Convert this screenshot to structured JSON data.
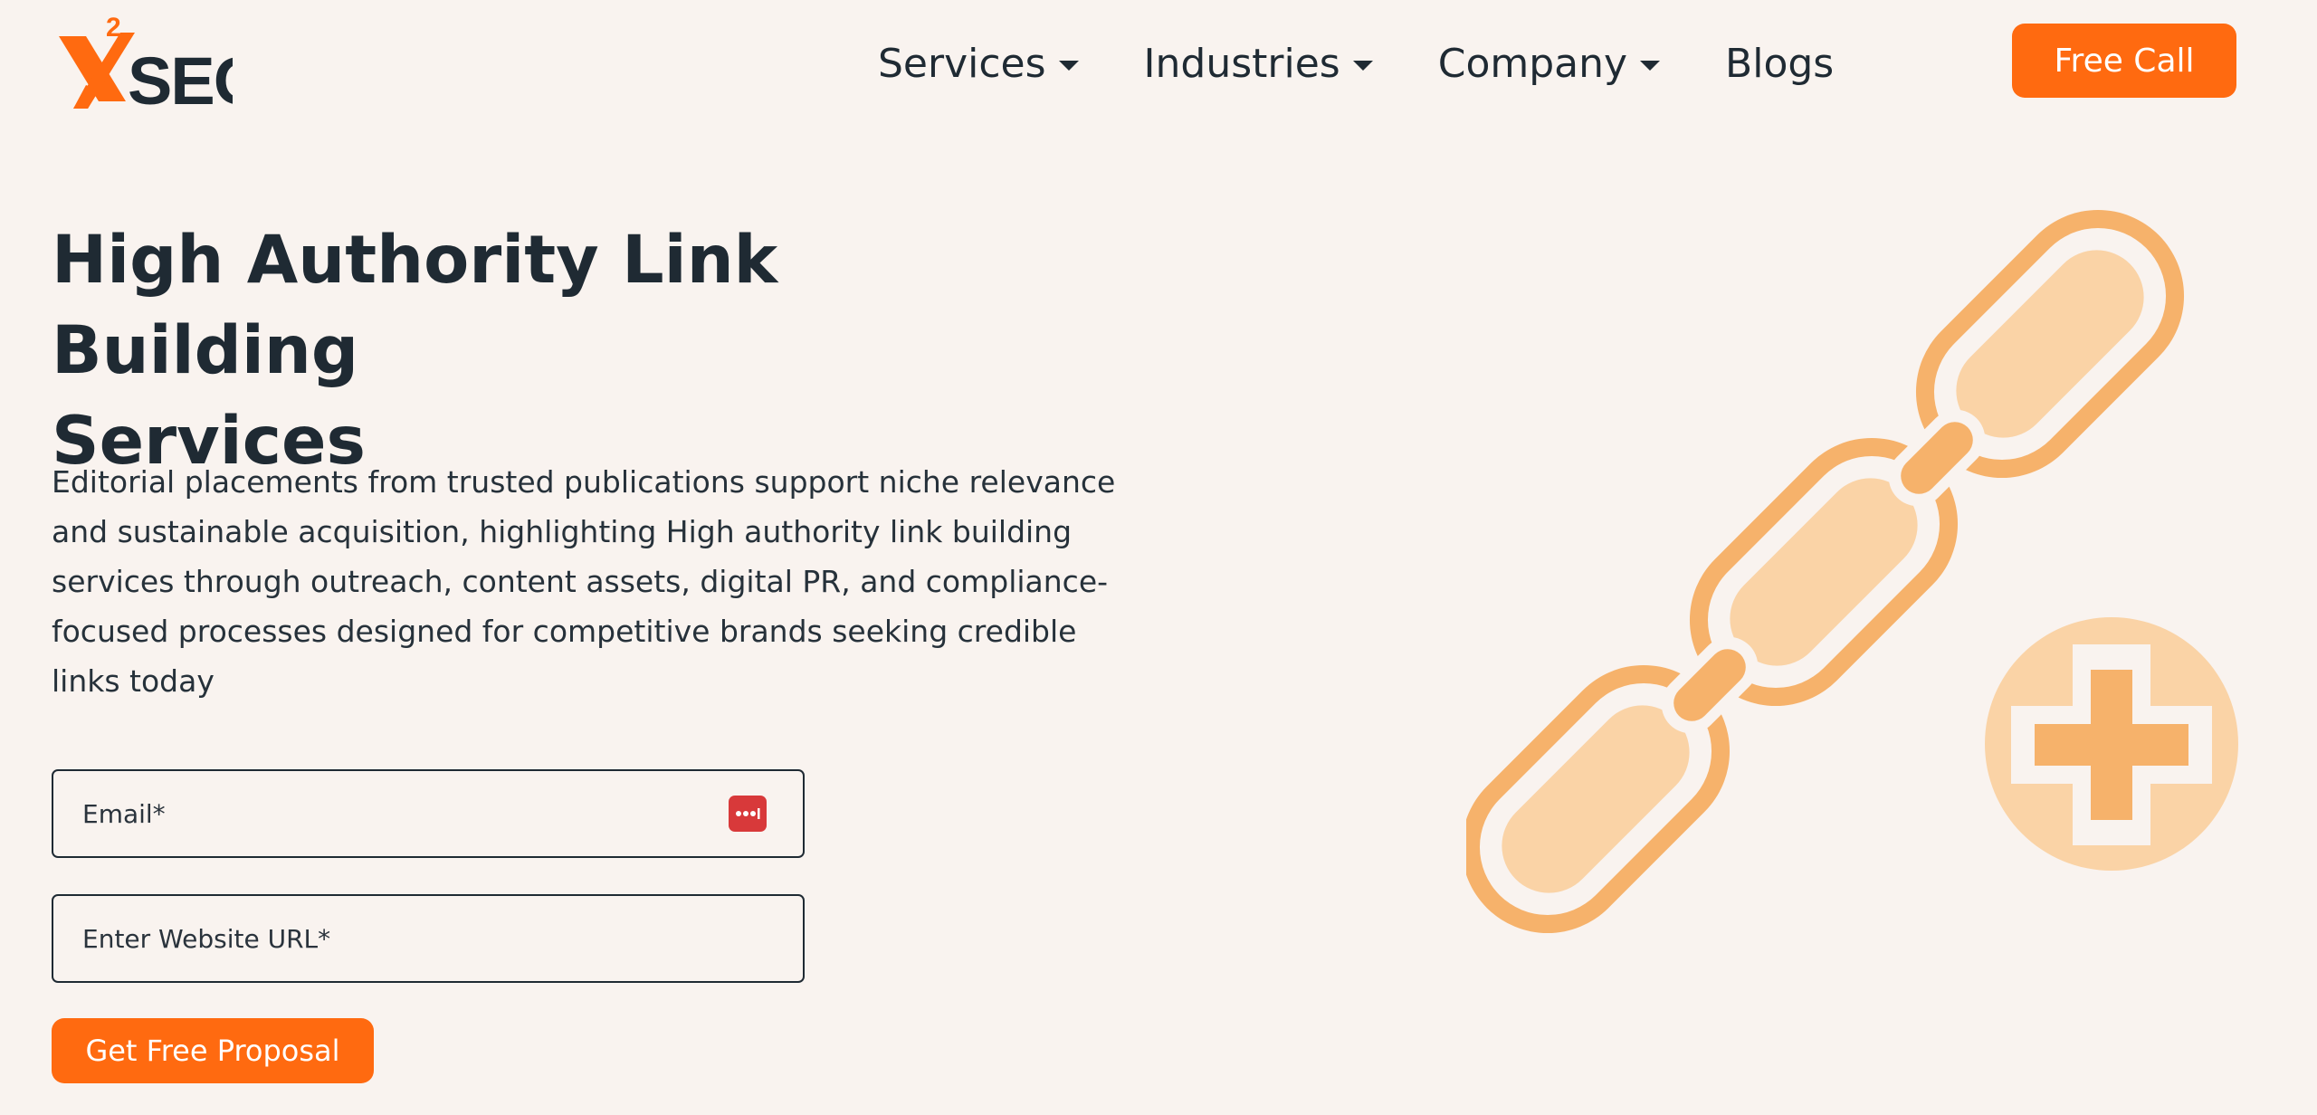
{
  "header": {
    "logo": {
      "text": "XSEO",
      "superscript": "2"
    },
    "nav": [
      {
        "label": "Services",
        "has_dropdown": true
      },
      {
        "label": "Industries",
        "has_dropdown": true
      },
      {
        "label": "Company",
        "has_dropdown": true
      },
      {
        "label": "Blogs",
        "has_dropdown": false
      }
    ],
    "cta_label": "Free Call"
  },
  "hero": {
    "title_line1": "High Authority Link Building",
    "title_line2": "Services",
    "description": "Editorial placements from trusted publications support niche relevance and sustainable acquisition, highlighting High authority link building services through outreach, content assets, digital PR, and compliance-focused processes designed for competitive brands seeking credible links today"
  },
  "form": {
    "email_placeholder": "Email*",
    "url_placeholder": "Enter Website URL*",
    "submit_label": "Get Free Proposal"
  },
  "illustration": {
    "icons": [
      "chain-link-icon",
      "plus-circle-icon"
    ]
  },
  "colors": {
    "brand_orange": "#ff6a10",
    "background": "#f9f3ef",
    "text_dark": "#1f2a33",
    "illustration_dark": "#f6b26b",
    "illustration_light": "#fad3a6",
    "password_icon_red": "#d8393a"
  }
}
